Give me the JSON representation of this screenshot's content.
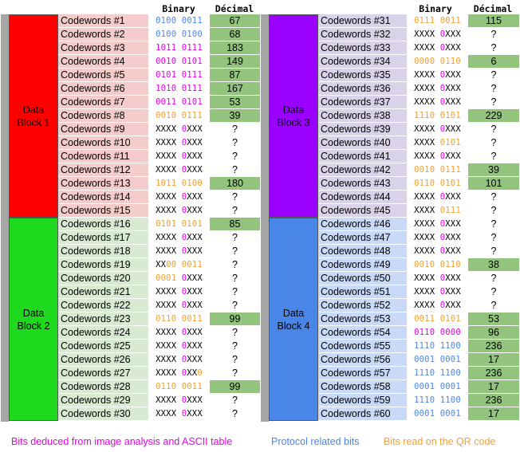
{
  "colors": {
    "pink": "#e600e6",
    "blue": "#4a86e8",
    "orange": "#f0a030",
    "black": "#000000",
    "known_bg": "#93c47d",
    "block1": "#ff0000",
    "block2": "#1ed91e",
    "block3": "#9900ff",
    "block4": "#4a86e8",
    "label_bg_block1": "#f4cccc",
    "label_bg_block2": "#d9ead3",
    "label_bg_block3": "#d9d2e9",
    "label_bg_block4": "#c9daf8"
  },
  "headers": {
    "left_binary": "Binary",
    "left_decimal": "Décimal",
    "right_binary": "Binary",
    "right_decimal": "Décimal"
  },
  "blocks": [
    {
      "name": "Data Block 1",
      "line1": "Data",
      "line2": "Block 1",
      "color": "block1"
    },
    {
      "name": "Data Block 2",
      "line1": "Data",
      "line2": "Block 2",
      "color": "block2"
    },
    {
      "name": "Data Block 3",
      "line1": "Data",
      "line2": "Block 3",
      "color": "block3"
    },
    {
      "name": "Data Block 4",
      "line1": "Data",
      "line2": "Block 4",
      "color": "block4"
    }
  ],
  "left_rows": [
    {
      "label": "Codewords #1",
      "binary": [
        [
          "0100 0011",
          "blue"
        ]
      ],
      "decimal": "67"
    },
    {
      "label": "Codewords #2",
      "binary": [
        [
          "0100 0100",
          "blue"
        ]
      ],
      "decimal": "68"
    },
    {
      "label": "Codewords #3",
      "binary": [
        [
          "1011 0111",
          "pink"
        ]
      ],
      "decimal": "183"
    },
    {
      "label": "Codewords #4",
      "binary": [
        [
          "0010 0101",
          "pink"
        ]
      ],
      "decimal": "149"
    },
    {
      "label": "Codewords #5",
      "binary": [
        [
          "0101 0111",
          "pink"
        ]
      ],
      "decimal": "87"
    },
    {
      "label": "Codewords #6",
      "binary": [
        [
          "1010 0111",
          "pink"
        ]
      ],
      "decimal": "167"
    },
    {
      "label": "Codewords #7",
      "binary": [
        [
          "0011 0101",
          "pink"
        ]
      ],
      "decimal": "53"
    },
    {
      "label": "Codewords #8",
      "binary": [
        [
          "0010 0111",
          "orange"
        ]
      ],
      "decimal": "39"
    },
    {
      "label": "Codewords #9",
      "binary": [
        [
          "XXXX ",
          "black"
        ],
        [
          "0",
          "pink"
        ],
        [
          "XXX",
          "black"
        ]
      ],
      "decimal": "?"
    },
    {
      "label": "Codewords #10",
      "binary": [
        [
          "XXXX ",
          "black"
        ],
        [
          "0",
          "pink"
        ],
        [
          "XXX",
          "black"
        ]
      ],
      "decimal": "?"
    },
    {
      "label": "Codewords #11",
      "binary": [
        [
          "XXXX ",
          "black"
        ],
        [
          "0",
          "pink"
        ],
        [
          "XXX",
          "black"
        ]
      ],
      "decimal": "?"
    },
    {
      "label": "Codewords #12",
      "binary": [
        [
          "XXXX ",
          "black"
        ],
        [
          "0",
          "pink"
        ],
        [
          "XXX",
          "black"
        ]
      ],
      "decimal": "?"
    },
    {
      "label": "Codewords #13",
      "binary": [
        [
          "1011 0100",
          "orange"
        ]
      ],
      "decimal": "180"
    },
    {
      "label": "Codewords #14",
      "binary": [
        [
          "XXXX ",
          "black"
        ],
        [
          "0",
          "pink"
        ],
        [
          "XXX",
          "black"
        ]
      ],
      "decimal": "?"
    },
    {
      "label": "Codewords #15",
      "binary": [
        [
          "XXXX ",
          "black"
        ],
        [
          "0",
          "pink"
        ],
        [
          "XXX",
          "black"
        ]
      ],
      "decimal": "?"
    },
    {
      "label": "Codewords #16",
      "binary": [
        [
          "0101 0101",
          "orange"
        ]
      ],
      "decimal": "85"
    },
    {
      "label": "Codewords #17",
      "binary": [
        [
          "XXXX ",
          "black"
        ],
        [
          "0",
          "pink"
        ],
        [
          "XXX",
          "black"
        ]
      ],
      "decimal": "?"
    },
    {
      "label": "Codewords #18",
      "binary": [
        [
          "XXXX ",
          "black"
        ],
        [
          "0",
          "pink"
        ],
        [
          "XXX",
          "black"
        ]
      ],
      "decimal": "?"
    },
    {
      "label": "Codewords #19",
      "binary": [
        [
          "XX",
          "black"
        ],
        [
          "00 0011",
          "orange"
        ]
      ],
      "decimal": "?"
    },
    {
      "label": "Codewords #20",
      "binary": [
        [
          "0001 ",
          "orange"
        ],
        [
          "0",
          "pink"
        ],
        [
          "XXX",
          "black"
        ]
      ],
      "decimal": "?"
    },
    {
      "label": "Codewords #21",
      "binary": [
        [
          "XXXX ",
          "black"
        ],
        [
          "0",
          "pink"
        ],
        [
          "XXX",
          "black"
        ]
      ],
      "decimal": "?"
    },
    {
      "label": "Codewords #22",
      "binary": [
        [
          "XXXX ",
          "black"
        ],
        [
          "0",
          "pink"
        ],
        [
          "XXX",
          "black"
        ]
      ],
      "decimal": "?"
    },
    {
      "label": "Codewords #23",
      "binary": [
        [
          "0110 0011",
          "orange"
        ]
      ],
      "decimal": "99"
    },
    {
      "label": "Codewords #24",
      "binary": [
        [
          "XXXX ",
          "black"
        ],
        [
          "0",
          "pink"
        ],
        [
          "XXX",
          "black"
        ]
      ],
      "decimal": "?"
    },
    {
      "label": "Codewords #25",
      "binary": [
        [
          "XXXX ",
          "black"
        ],
        [
          "0",
          "pink"
        ],
        [
          "XXX",
          "black"
        ]
      ],
      "decimal": "?"
    },
    {
      "label": "Codewords #26",
      "binary": [
        [
          "XXXX ",
          "black"
        ],
        [
          "0",
          "pink"
        ],
        [
          "XXX",
          "black"
        ]
      ],
      "decimal": "?"
    },
    {
      "label": "Codewords #27",
      "binary": [
        [
          "XXXX ",
          "black"
        ],
        [
          "0",
          "pink"
        ],
        [
          "XX",
          "black"
        ],
        [
          "0",
          "orange"
        ]
      ],
      "decimal": "?"
    },
    {
      "label": "Codewords #28",
      "binary": [
        [
          "0110 0011",
          "orange"
        ]
      ],
      "decimal": "99"
    },
    {
      "label": "Codewords #29",
      "binary": [
        [
          "XXXX ",
          "black"
        ],
        [
          "0",
          "pink"
        ],
        [
          "XXX",
          "black"
        ]
      ],
      "decimal": "?"
    },
    {
      "label": "Codewords #30",
      "binary": [
        [
          "XXXX ",
          "black"
        ],
        [
          "0",
          "pink"
        ],
        [
          "XXX",
          "black"
        ]
      ],
      "decimal": "?"
    }
  ],
  "right_rows": [
    {
      "label": "Codewords #31",
      "binary": [
        [
          "0111 0011",
          "orange"
        ]
      ],
      "decimal": "115"
    },
    {
      "label": "Codewords #32",
      "binary": [
        [
          "XXXX ",
          "black"
        ],
        [
          "0",
          "pink"
        ],
        [
          "XXX",
          "black"
        ]
      ],
      "decimal": "?"
    },
    {
      "label": "Codewords #33",
      "binary": [
        [
          "XXXX ",
          "black"
        ],
        [
          "0",
          "pink"
        ],
        [
          "XXX",
          "black"
        ]
      ],
      "decimal": "?"
    },
    {
      "label": "Codewords #34",
      "binary": [
        [
          "0000 0110",
          "orange"
        ]
      ],
      "decimal": "6"
    },
    {
      "label": "Codewords #35",
      "binary": [
        [
          "XXXX ",
          "black"
        ],
        [
          "0",
          "pink"
        ],
        [
          "XXX",
          "black"
        ]
      ],
      "decimal": "?"
    },
    {
      "label": "Codewords #36",
      "binary": [
        [
          "XXXX ",
          "black"
        ],
        [
          "0",
          "pink"
        ],
        [
          "XXX",
          "black"
        ]
      ],
      "decimal": "?"
    },
    {
      "label": "Codewords #37",
      "binary": [
        [
          "XXXX ",
          "black"
        ],
        [
          "0",
          "pink"
        ],
        [
          "XXX",
          "black"
        ]
      ],
      "decimal": "?"
    },
    {
      "label": "Codewords #38",
      "binary": [
        [
          "1110 0101",
          "orange"
        ]
      ],
      "decimal": "229"
    },
    {
      "label": "Codewords #39",
      "binary": [
        [
          "XXXX ",
          "black"
        ],
        [
          "0",
          "pink"
        ],
        [
          "XXX",
          "black"
        ]
      ],
      "decimal": "?"
    },
    {
      "label": "Codewords #40",
      "binary": [
        [
          "XXXX ",
          "black"
        ],
        [
          "0101",
          "orange"
        ]
      ],
      "decimal": "?"
    },
    {
      "label": "Codewords #41",
      "binary": [
        [
          "XXXX ",
          "black"
        ],
        [
          "0",
          "pink"
        ],
        [
          "XXX",
          "black"
        ]
      ],
      "decimal": "?"
    },
    {
      "label": "Codewords #42",
      "binary": [
        [
          "0010 0111",
          "orange"
        ]
      ],
      "decimal": "39"
    },
    {
      "label": "Codewords #43",
      "binary": [
        [
          "0110 0101",
          "orange"
        ]
      ],
      "decimal": "101"
    },
    {
      "label": "Codewords #44",
      "binary": [
        [
          "XXXX ",
          "black"
        ],
        [
          "0",
          "pink"
        ],
        [
          "XXX",
          "black"
        ]
      ],
      "decimal": "?"
    },
    {
      "label": "Codewords #45",
      "binary": [
        [
          "XXXX ",
          "black"
        ],
        [
          "0111",
          "orange"
        ]
      ],
      "decimal": "?"
    },
    {
      "label": "Codewords #46",
      "binary": [
        [
          "XXXX ",
          "black"
        ],
        [
          "0",
          "pink"
        ],
        [
          "XXX",
          "black"
        ]
      ],
      "decimal": "?"
    },
    {
      "label": "Codewords #47",
      "binary": [
        [
          "XXXX ",
          "black"
        ],
        [
          "0",
          "pink"
        ],
        [
          "XXX",
          "black"
        ]
      ],
      "decimal": "?"
    },
    {
      "label": "Codewords #48",
      "binary": [
        [
          "XXXX ",
          "black"
        ],
        [
          "0",
          "pink"
        ],
        [
          "XXX",
          "black"
        ]
      ],
      "decimal": "?"
    },
    {
      "label": "Codewords #49",
      "binary": [
        [
          "0010 0110",
          "orange"
        ]
      ],
      "decimal": "38"
    },
    {
      "label": "Codewords #50",
      "binary": [
        [
          "XXXX ",
          "black"
        ],
        [
          "0",
          "pink"
        ],
        [
          "XXX",
          "black"
        ]
      ],
      "decimal": "?"
    },
    {
      "label": "Codewords #51",
      "binary": [
        [
          "XXXX ",
          "black"
        ],
        [
          "0",
          "pink"
        ],
        [
          "XXX",
          "black"
        ]
      ],
      "decimal": "?"
    },
    {
      "label": "Codewords #52",
      "binary": [
        [
          "XXXX ",
          "black"
        ],
        [
          "0",
          "pink"
        ],
        [
          "XXX",
          "black"
        ]
      ],
      "decimal": "?"
    },
    {
      "label": "Codewords #53",
      "binary": [
        [
          "0011 0101",
          "orange"
        ]
      ],
      "decimal": "53"
    },
    {
      "label": "Codewords #54",
      "binary": [
        [
          "0110 0000",
          "pink"
        ]
      ],
      "decimal": "96"
    },
    {
      "label": "Codewords #55",
      "binary": [
        [
          "1110 1100",
          "blue"
        ]
      ],
      "decimal": "236"
    },
    {
      "label": "Codewords #56",
      "binary": [
        [
          "0001 0001",
          "blue"
        ]
      ],
      "decimal": "17"
    },
    {
      "label": "Codewords #57",
      "binary": [
        [
          "1110 1100",
          "blue"
        ]
      ],
      "decimal": "236"
    },
    {
      "label": "Codewords #58",
      "binary": [
        [
          "0001 0001",
          "blue"
        ]
      ],
      "decimal": "17"
    },
    {
      "label": "Codewords #59",
      "binary": [
        [
          "1110 1100",
          "blue"
        ]
      ],
      "decimal": "236"
    },
    {
      "label": "Codewords #60",
      "binary": [
        [
          "0001 0001",
          "blue"
        ]
      ],
      "decimal": "17"
    }
  ],
  "legend": [
    {
      "text": "Bits deduced from image analysis and ASCII table",
      "color": "pink"
    },
    {
      "text": "Protocol related bits",
      "color": "blue"
    },
    {
      "text": "Bits read on the QR code",
      "color": "orange"
    }
  ]
}
